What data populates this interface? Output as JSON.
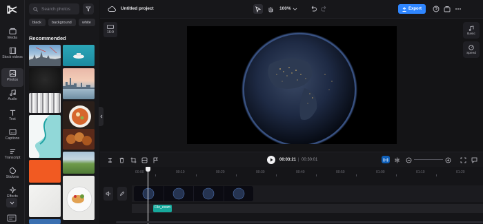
{
  "app": {
    "project_title": "Untitled project"
  },
  "rail": {
    "items": [
      {
        "label": "Media",
        "icon": "media-icon"
      },
      {
        "label": "Stock videos",
        "icon": "stock-videos-icon"
      },
      {
        "label": "Photos",
        "icon": "photos-icon",
        "active": true
      },
      {
        "label": "Audio",
        "icon": "audio-icon"
      },
      {
        "label": "Text",
        "icon": "text-icon"
      },
      {
        "label": "Captions",
        "icon": "captions-icon"
      },
      {
        "label": "Transcript",
        "icon": "transcript-icon"
      },
      {
        "label": "Stickers",
        "icon": "stickers-icon"
      },
      {
        "label": "Effects",
        "icon": "effects-icon"
      }
    ]
  },
  "panel": {
    "search_placeholder": "Search photos",
    "chips": [
      "black",
      "background",
      "white"
    ],
    "recommended_title": "Recommended"
  },
  "toolbar": {
    "zoom": "100%",
    "export_label": "Export"
  },
  "preview": {
    "ratio_label": "16:9",
    "side_buttons": [
      "Basic",
      "Speed"
    ]
  },
  "timeline": {
    "current_time": "00:03:21",
    "separator": "|",
    "total_time": "00:30:01",
    "ruler": [
      "00:00",
      "00:10",
      "00:20",
      "00:30",
      "00:40",
      "00:50",
      "01:00",
      "01:10",
      "01:20"
    ],
    "audio_clip_label": "File_exam"
  },
  "colors": {
    "accent": "#2f86ff",
    "audio_clip": "#17a99c",
    "background": "#141416"
  }
}
